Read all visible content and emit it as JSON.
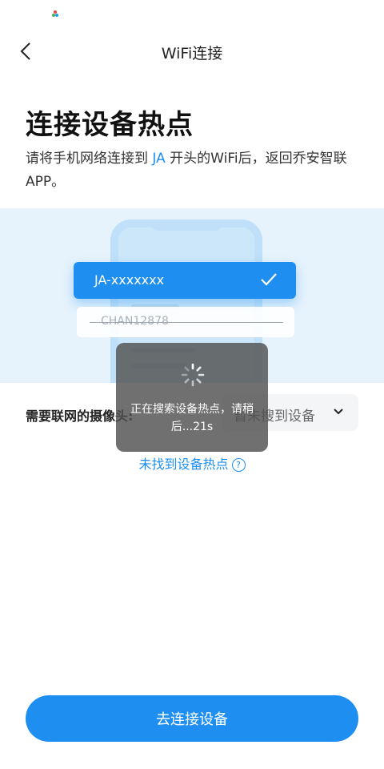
{
  "nav": {
    "title": "WiFi连接"
  },
  "page": {
    "heading": "连接设备热点",
    "desc_before": "请将手机网络连接到 ",
    "desc_highlight": "JA",
    "desc_after": " 开头的WiFi后，返回乔安智联APP。"
  },
  "illustration": {
    "selected_wifi": "JA-xxxxxxx",
    "other_wifi": "CHAN12878"
  },
  "camera": {
    "label": "需要联网的摄像头:",
    "select_value": "暂未搜到设备"
  },
  "help_link": {
    "text": "未找到设备热点",
    "icon": "?"
  },
  "toast": {
    "message": "正在搜索设备热点，请稍后...21s"
  },
  "cta": {
    "label": "去连接设备"
  },
  "colors": {
    "accent": "#1e8ff0"
  }
}
